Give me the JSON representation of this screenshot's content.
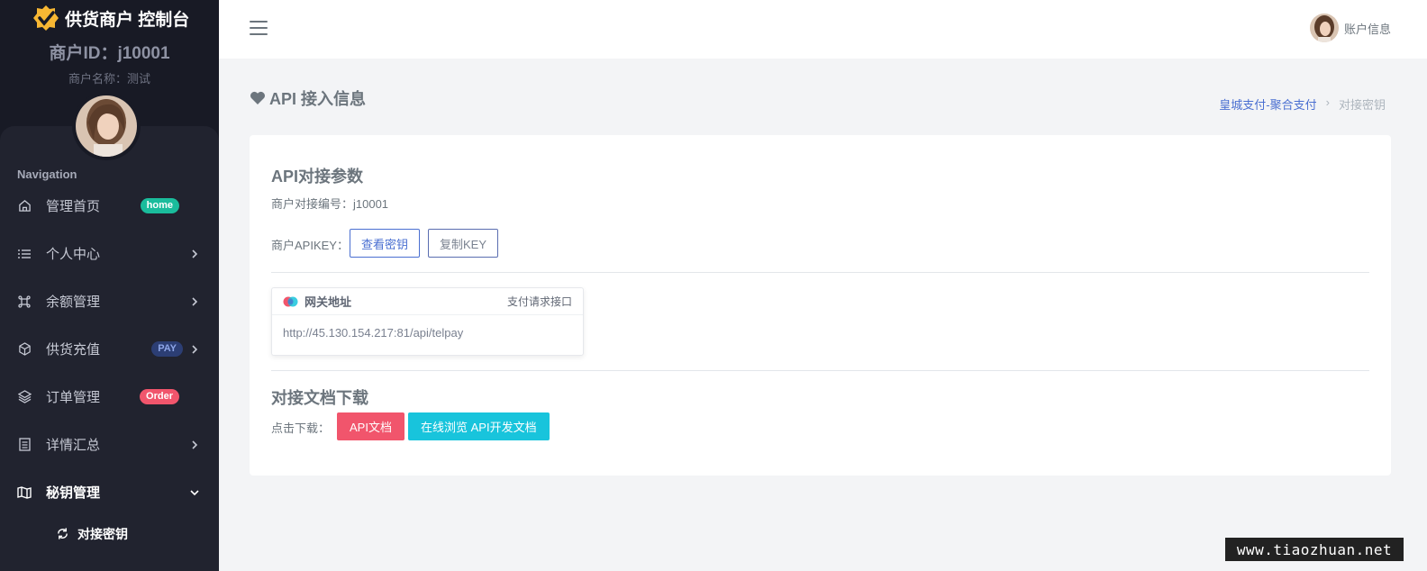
{
  "brand": {
    "title": "供货商户 控制台"
  },
  "merchant": {
    "id_text": "商户ID：j10001",
    "name_text": "商户名称：测试"
  },
  "nav": {
    "heading": "Navigation",
    "items": [
      {
        "label": "管理首页",
        "icon": "home-icon",
        "badge": "home"
      },
      {
        "label": "个人中心",
        "icon": "list-icon"
      },
      {
        "label": "余额管理",
        "icon": "command-icon"
      },
      {
        "label": "供货充值",
        "icon": "box-icon",
        "badge": "PAY"
      },
      {
        "label": "订单管理",
        "icon": "layers-icon",
        "badge": "Order"
      },
      {
        "label": "详情汇总",
        "icon": "document-icon"
      },
      {
        "label": "秘钥管理",
        "icon": "map-icon"
      }
    ],
    "sub_item": {
      "label": "对接密钥",
      "icon": "refresh-icon"
    }
  },
  "topbar": {
    "account_label": "账户信息"
  },
  "page": {
    "title": "API 接入信息"
  },
  "breadcrumb": {
    "parent": "皇城支付-聚合支付",
    "separator": "›",
    "current": "对接密钥"
  },
  "api_params": {
    "title": "API对接参数",
    "merchant_no": "商户对接编号：j10001",
    "apikey_label": "商户APIKEY：",
    "view_key_button": "查看密钥",
    "copy_key_button": "复制KEY"
  },
  "gateway": {
    "title": "网关地址",
    "tag": "支付请求接口",
    "url": "http://45.130.154.217:81/api/telpay"
  },
  "docs": {
    "title": "对接文档下载",
    "label": "点击下载：",
    "api_doc_button": "API文档",
    "online_doc_button": "在线浏览 API开发文档"
  },
  "watermark": "www.tiaozhuan.net",
  "colors": {
    "sidebar_bg": "#181a25",
    "accent_blue": "#4a6fd1",
    "pink": "#f1556c",
    "cyan": "#18c4dc",
    "green": "#1abc9c"
  }
}
